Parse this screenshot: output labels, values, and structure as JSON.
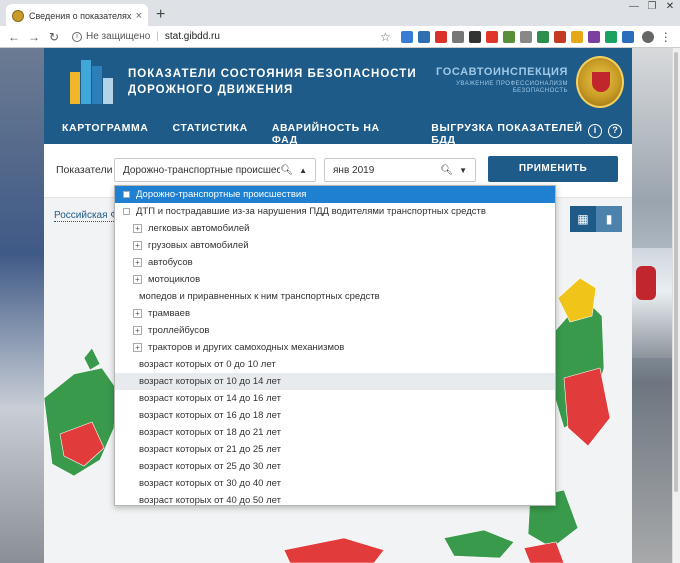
{
  "browser": {
    "tab_title": "Сведения о показателях состояния",
    "tab_close": "×",
    "new_tab": "+",
    "address": {
      "security_label": "Не защищено",
      "separator": "|",
      "url": "stat.gibdd.ru"
    },
    "extensions": [
      {
        "name": "ext-1",
        "color": "#3a7bd5"
      },
      {
        "name": "ext-2",
        "color": "#2d6fb0"
      },
      {
        "name": "ext-3",
        "color": "#d9332b"
      },
      {
        "name": "ext-4",
        "color": "#777777"
      },
      {
        "name": "ext-5",
        "color": "#333333"
      },
      {
        "name": "ext-6",
        "color": "#e0352b"
      },
      {
        "name": "ext-7",
        "color": "#5a8f3a"
      },
      {
        "name": "ext-8",
        "color": "#888888"
      },
      {
        "name": "ext-9",
        "color": "#2d8f4e"
      },
      {
        "name": "ext-10",
        "color": "#c23b22"
      },
      {
        "name": "ext-11",
        "color": "#e6a817"
      },
      {
        "name": "ext-12",
        "color": "#7b3fa0"
      },
      {
        "name": "ext-13",
        "color": "#1aa260"
      },
      {
        "name": "ext-14",
        "color": "#2a6ebb"
      }
    ]
  },
  "site": {
    "title_line1": "ПОКАЗАТЕЛИ СОСТОЯНИЯ БЕЗОПАСНОСТИ",
    "title_line2": "ДОРОЖНОГО ДВИЖЕНИЯ",
    "gibdd_name": "ГОСАВТОИНСПЕКЦИЯ",
    "gibdd_slogan_1": "УВАЖЕНИЕ ПРОФЕССИОНАЛИЗМ",
    "gibdd_slogan_2": "БЕЗОПАСНОСТЬ",
    "nav": [
      {
        "label": "КАРТОГРАММА",
        "active": true
      },
      {
        "label": "СТАТИСТИКА",
        "active": false
      },
      {
        "label": "АВАРИЙНОСТЬ НА ФАД",
        "active": false
      },
      {
        "label": "ВЫГРУЗКА ПОКАЗАТЕЛЕЙ БДД",
        "active": false
      }
    ],
    "info_icon": "i",
    "help_icon": "?"
  },
  "filters": {
    "label": "Показатели",
    "indicator_value": "Дорожно-транспортные происшест...",
    "date_value": "янв 2019",
    "apply_label": "ПРИМЕНИТЬ"
  },
  "map": {
    "region_link": "Российская Ф",
    "colors": {
      "green": "#3a9a4c",
      "red": "#e23b3b",
      "yellow": "#f0c419"
    }
  },
  "dropdown": {
    "items": [
      {
        "label": "Дорожно-транспортные происшествия",
        "level": 0,
        "marker": "box",
        "state": "selected"
      },
      {
        "label": "ДТП и пострадавшие из-за нарушения ПДД водителями транспортных средств",
        "level": 0,
        "marker": "box",
        "state": ""
      },
      {
        "label": "легковых автомобилей",
        "level": 1,
        "marker": "plus",
        "state": ""
      },
      {
        "label": "грузовых автомобилей",
        "level": 1,
        "marker": "plus",
        "state": ""
      },
      {
        "label": "автобусов",
        "level": 1,
        "marker": "plus",
        "state": ""
      },
      {
        "label": "мотоциклов",
        "level": 1,
        "marker": "plus",
        "state": ""
      },
      {
        "label": "мопедов и приравненных к ним транспортных средств",
        "level": 2,
        "marker": "none",
        "state": ""
      },
      {
        "label": "трамваев",
        "level": 1,
        "marker": "plus",
        "state": ""
      },
      {
        "label": "троллейбусов",
        "level": 1,
        "marker": "plus",
        "state": ""
      },
      {
        "label": "тракторов и других самоходных механизмов",
        "level": 1,
        "marker": "plus",
        "state": ""
      },
      {
        "label": "возраст которых от 0 до 10 лет",
        "level": 2,
        "marker": "none",
        "state": ""
      },
      {
        "label": "возраст которых от 10 до 14 лет",
        "level": 2,
        "marker": "none",
        "state": "hover"
      },
      {
        "label": "возраст которых от 14 до 16 лет",
        "level": 2,
        "marker": "none",
        "state": ""
      },
      {
        "label": "возраст которых от 16 до 18 лет",
        "level": 2,
        "marker": "none",
        "state": ""
      },
      {
        "label": "возраст которых от 18 до 21 лет",
        "level": 2,
        "marker": "none",
        "state": ""
      },
      {
        "label": "возраст которых от 21 до 25 лет",
        "level": 2,
        "marker": "none",
        "state": ""
      },
      {
        "label": "возраст которых от 25 до 30 лет",
        "level": 2,
        "marker": "none",
        "state": ""
      },
      {
        "label": "возраст которых от 30 до 40 лет",
        "level": 2,
        "marker": "none",
        "state": ""
      },
      {
        "label": "возраст которых от 40 до 50 лет",
        "level": 2,
        "marker": "none",
        "state": ""
      }
    ]
  }
}
